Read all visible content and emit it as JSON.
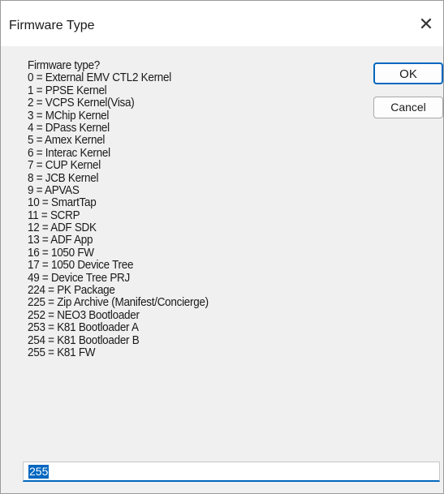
{
  "window": {
    "title": "Firmware Type",
    "close_label": "✕"
  },
  "prompt": {
    "lines": [
      "Firmware type?",
      "0 = External EMV CTL2 Kernel",
      "1 = PPSE Kernel",
      "2 = VCPS Kernel(Visa)",
      "3 = MChip Kernel",
      "4 = DPass Kernel",
      "5 = Amex Kernel",
      "6 = Interac Kernel",
      "7 = CUP Kernel",
      "8 = JCB Kernel",
      "9 = APVAS",
      "10 = SmartTap",
      "11 = SCRP",
      "12 = ADF SDK",
      "13 = ADF App",
      "16 = 1050 FW",
      "17 = 1050 Device Tree",
      "49 = Device Tree PRJ",
      "224 = PK Package",
      "225 = Zip Archive (Manifest/Concierge)",
      "252 = NEO3 Bootloader",
      "253 = K81 Bootloader A",
      "254 = K81 Bootloader B",
      "255 = K81 FW"
    ]
  },
  "buttons": {
    "ok_label": "OK",
    "cancel_label": "Cancel"
  },
  "input": {
    "value": "255"
  },
  "colors": {
    "accent": "#0067c0",
    "dialog_bg": "#f0f0f0",
    "titlebar_bg": "#ffffff"
  }
}
